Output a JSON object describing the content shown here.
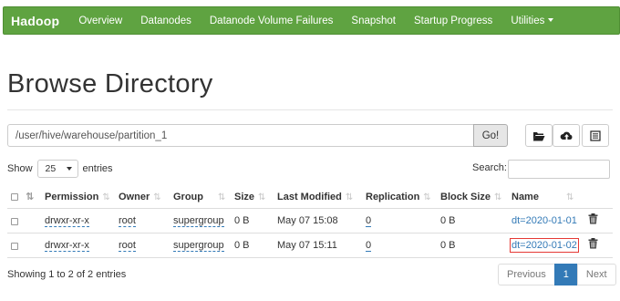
{
  "navbar": {
    "brand": "Hadoop",
    "items": [
      {
        "label": "Overview"
      },
      {
        "label": "Datanodes"
      },
      {
        "label": "Datanode Volume Failures"
      },
      {
        "label": "Snapshot"
      },
      {
        "label": "Startup Progress"
      },
      {
        "label": "Utilities"
      }
    ]
  },
  "page": {
    "title": "Browse Directory"
  },
  "pathbar": {
    "path": "/user/hive/warehouse/partition_1",
    "go_label": "Go!"
  },
  "toolbar": {
    "icons": [
      "folder-open-icon",
      "cloud-upload-icon",
      "list-icon"
    ]
  },
  "list_controls": {
    "show_label": "Show",
    "page_size": "25",
    "entries_label": "entries",
    "search_label": "Search:",
    "search_value": ""
  },
  "table": {
    "headers": {
      "permission": "Permission",
      "owner": "Owner",
      "group": "Group",
      "size": "Size",
      "last_modified": "Last Modified",
      "replication": "Replication",
      "block_size": "Block Size",
      "name": "Name"
    },
    "rows": [
      {
        "permission": "drwxr-xr-x",
        "owner": "root",
        "group": "supergroup",
        "size": "0 B",
        "last_modified": "May 07 15:08",
        "replication": "0",
        "block_size": "0 B",
        "name": "dt=2020-01-01",
        "highlighted": false
      },
      {
        "permission": "drwxr-xr-x",
        "owner": "root",
        "group": "supergroup",
        "size": "0 B",
        "last_modified": "May 07 15:11",
        "replication": "0",
        "block_size": "0 B",
        "name": "dt=2020-01-02",
        "highlighted": true
      }
    ]
  },
  "footer": {
    "info": "Showing 1 to 2 of 2 entries",
    "prev_label": "Previous",
    "current_page": "1",
    "next_label": "Next"
  },
  "colors": {
    "navbar_bg": "#5fa341",
    "link": "#337ab7",
    "highlight_border": "#e53935"
  }
}
